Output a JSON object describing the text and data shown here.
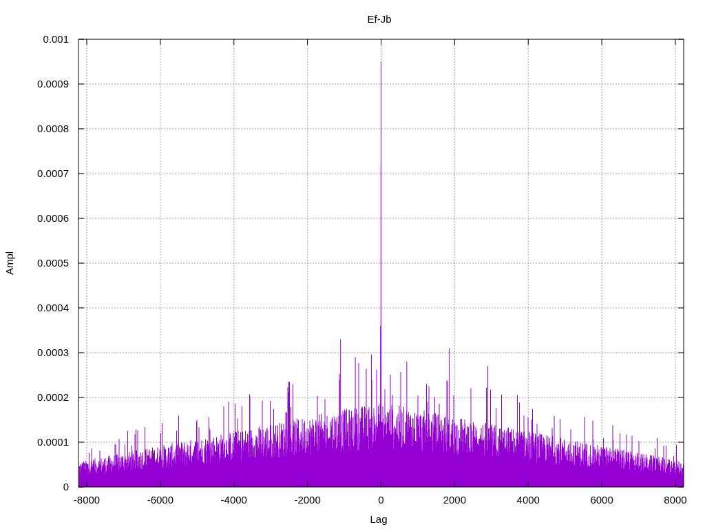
{
  "plot": {
    "title": "Ef-Jb",
    "xlabel": "Lag",
    "ylabel": "Ampl",
    "yticks": [
      "0.001",
      "0.0009",
      "0.0008",
      "0.0007",
      "0.0006",
      "0.0005",
      "0.0004",
      "0.0003",
      "0.0002",
      "0.0001",
      "0"
    ],
    "xticks": [
      "-8000",
      "-6000",
      "-4000",
      "-2000",
      "0",
      "2000",
      "4000",
      "6000",
      "8000"
    ]
  }
}
